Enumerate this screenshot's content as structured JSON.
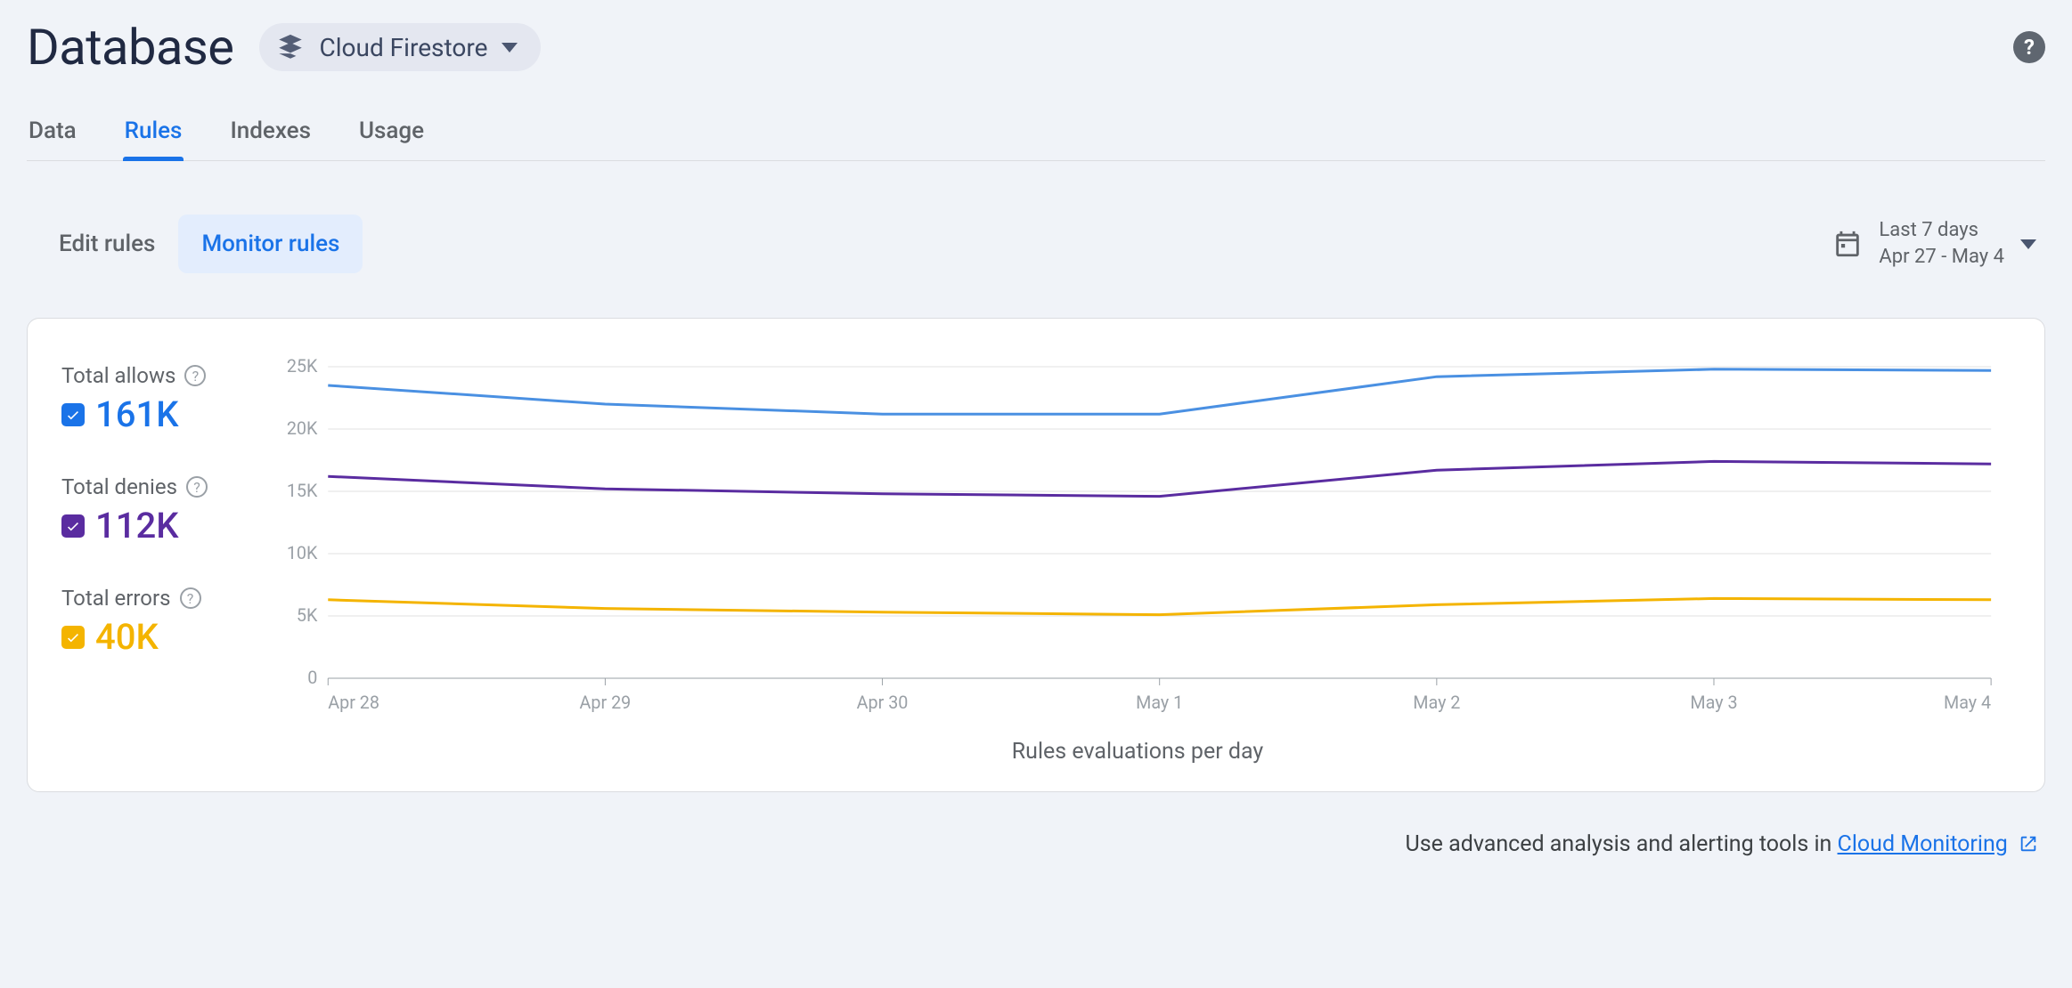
{
  "header": {
    "title": "Database",
    "selector_label": "Cloud Firestore"
  },
  "top_tabs": [
    {
      "label": "Data",
      "active": false
    },
    {
      "label": "Rules",
      "active": true
    },
    {
      "label": "Indexes",
      "active": false
    },
    {
      "label": "Usage",
      "active": false
    }
  ],
  "sub_tabs": [
    {
      "label": "Edit rules",
      "active": false
    },
    {
      "label": "Monitor rules",
      "active": true
    }
  ],
  "date_range": {
    "label": "Last 7 days",
    "range": "Apr 27 - May 4"
  },
  "legend": {
    "allows": {
      "title": "Total allows",
      "value": "161K",
      "color": "#1a73e8"
    },
    "denies": {
      "title": "Total denies",
      "value": "112K",
      "color": "#5a2ca0"
    },
    "errors": {
      "title": "Total errors",
      "value": "40K",
      "color": "#f4b400"
    }
  },
  "chart_caption": "Rules evaluations per day",
  "footer": {
    "text_prefix": "Use advanced analysis and alerting tools in ",
    "link_label": "Cloud Monitoring"
  },
  "chart_data": {
    "type": "line",
    "title": "Rules evaluations per day",
    "xlabel": "Rules evaluations per day",
    "ylabel": "",
    "ylim": [
      0,
      25000
    ],
    "y_ticks": [
      "0",
      "5K",
      "10K",
      "15K",
      "20K",
      "25K"
    ],
    "categories": [
      "Apr 28",
      "Apr 29",
      "Apr 30",
      "May 1",
      "May 2",
      "May 3",
      "May 4"
    ],
    "series": [
      {
        "name": "Total allows",
        "color": "#4a90e2",
        "values": [
          23500,
          22000,
          21200,
          21200,
          24200,
          24800,
          24700
        ]
      },
      {
        "name": "Total denies",
        "color": "#5a2ca0",
        "values": [
          16200,
          15200,
          14800,
          14600,
          16700,
          17400,
          17200
        ]
      },
      {
        "name": "Total errors",
        "color": "#f4b400",
        "values": [
          6300,
          5600,
          5300,
          5100,
          5900,
          6400,
          6300
        ]
      }
    ]
  }
}
